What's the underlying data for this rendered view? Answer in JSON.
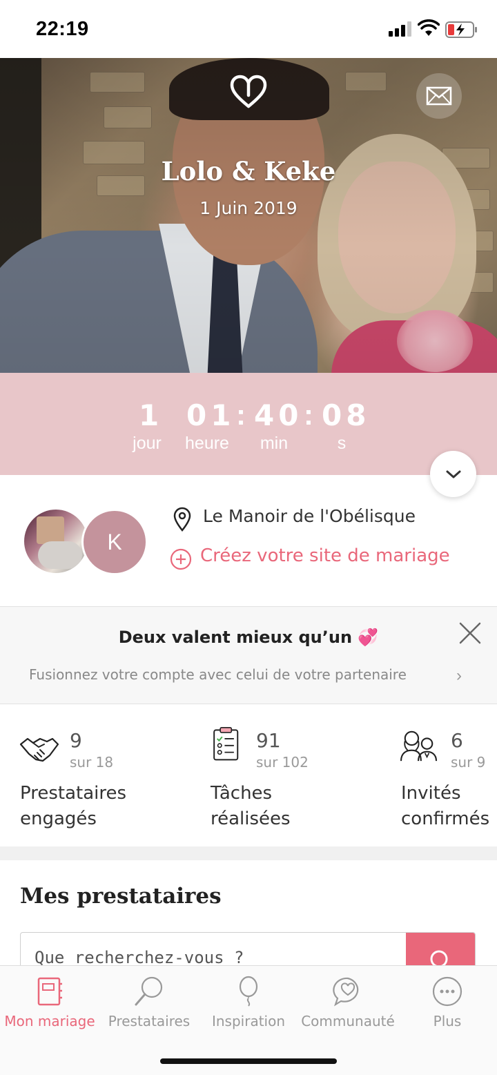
{
  "status": {
    "time": "22:19"
  },
  "hero": {
    "couple": "Lolo & Keke",
    "date": "1 Juin 2019"
  },
  "countdown": {
    "days": "1",
    "hours": "01",
    "minutes": "40",
    "seconds": "08",
    "days_label": "jour",
    "hours_label": "heure",
    "minutes_label": "min",
    "seconds_label": "s"
  },
  "profile": {
    "partner_initial": "K",
    "venue": "Le Manoir de l'Obélisque",
    "create_site": "Créez votre site de mariage"
  },
  "promo": {
    "title": "Deux valent mieux qu’un 💞",
    "subtitle": "Fusionnez votre compte avec celui de votre partenaire",
    "chevron": "›"
  },
  "stats": [
    {
      "value": "9",
      "total": "sur 18",
      "label_1": "Prestataires",
      "label_2": "engagés",
      "icon": "handshake-icon"
    },
    {
      "value": "91",
      "total": "sur 102",
      "label_1": "Tâches",
      "label_2": "réalisées",
      "icon": "checklist-icon"
    },
    {
      "value": "6",
      "total": "sur 9",
      "label_1": "Invités",
      "label_2": "confirmés",
      "icon": "guests-icon"
    }
  ],
  "vendors": {
    "title": "Mes prestataires",
    "search_placeholder": "Que recherchez-vous ?"
  },
  "tabs": [
    {
      "label": "Mon mariage",
      "icon": "notebook-icon",
      "active": true
    },
    {
      "label": "Prestataires",
      "icon": "magnifier-icon",
      "active": false
    },
    {
      "label": "Inspiration",
      "icon": "balloon-icon",
      "active": false
    },
    {
      "label": "Communauté",
      "icon": "chat-heart-icon",
      "active": false
    },
    {
      "label": "Plus",
      "icon": "more-icon",
      "active": false
    }
  ],
  "colors": {
    "accent": "#e9677a",
    "countdown_bg": "#e8c6c9",
    "avatar_bg": "#c4939c"
  }
}
